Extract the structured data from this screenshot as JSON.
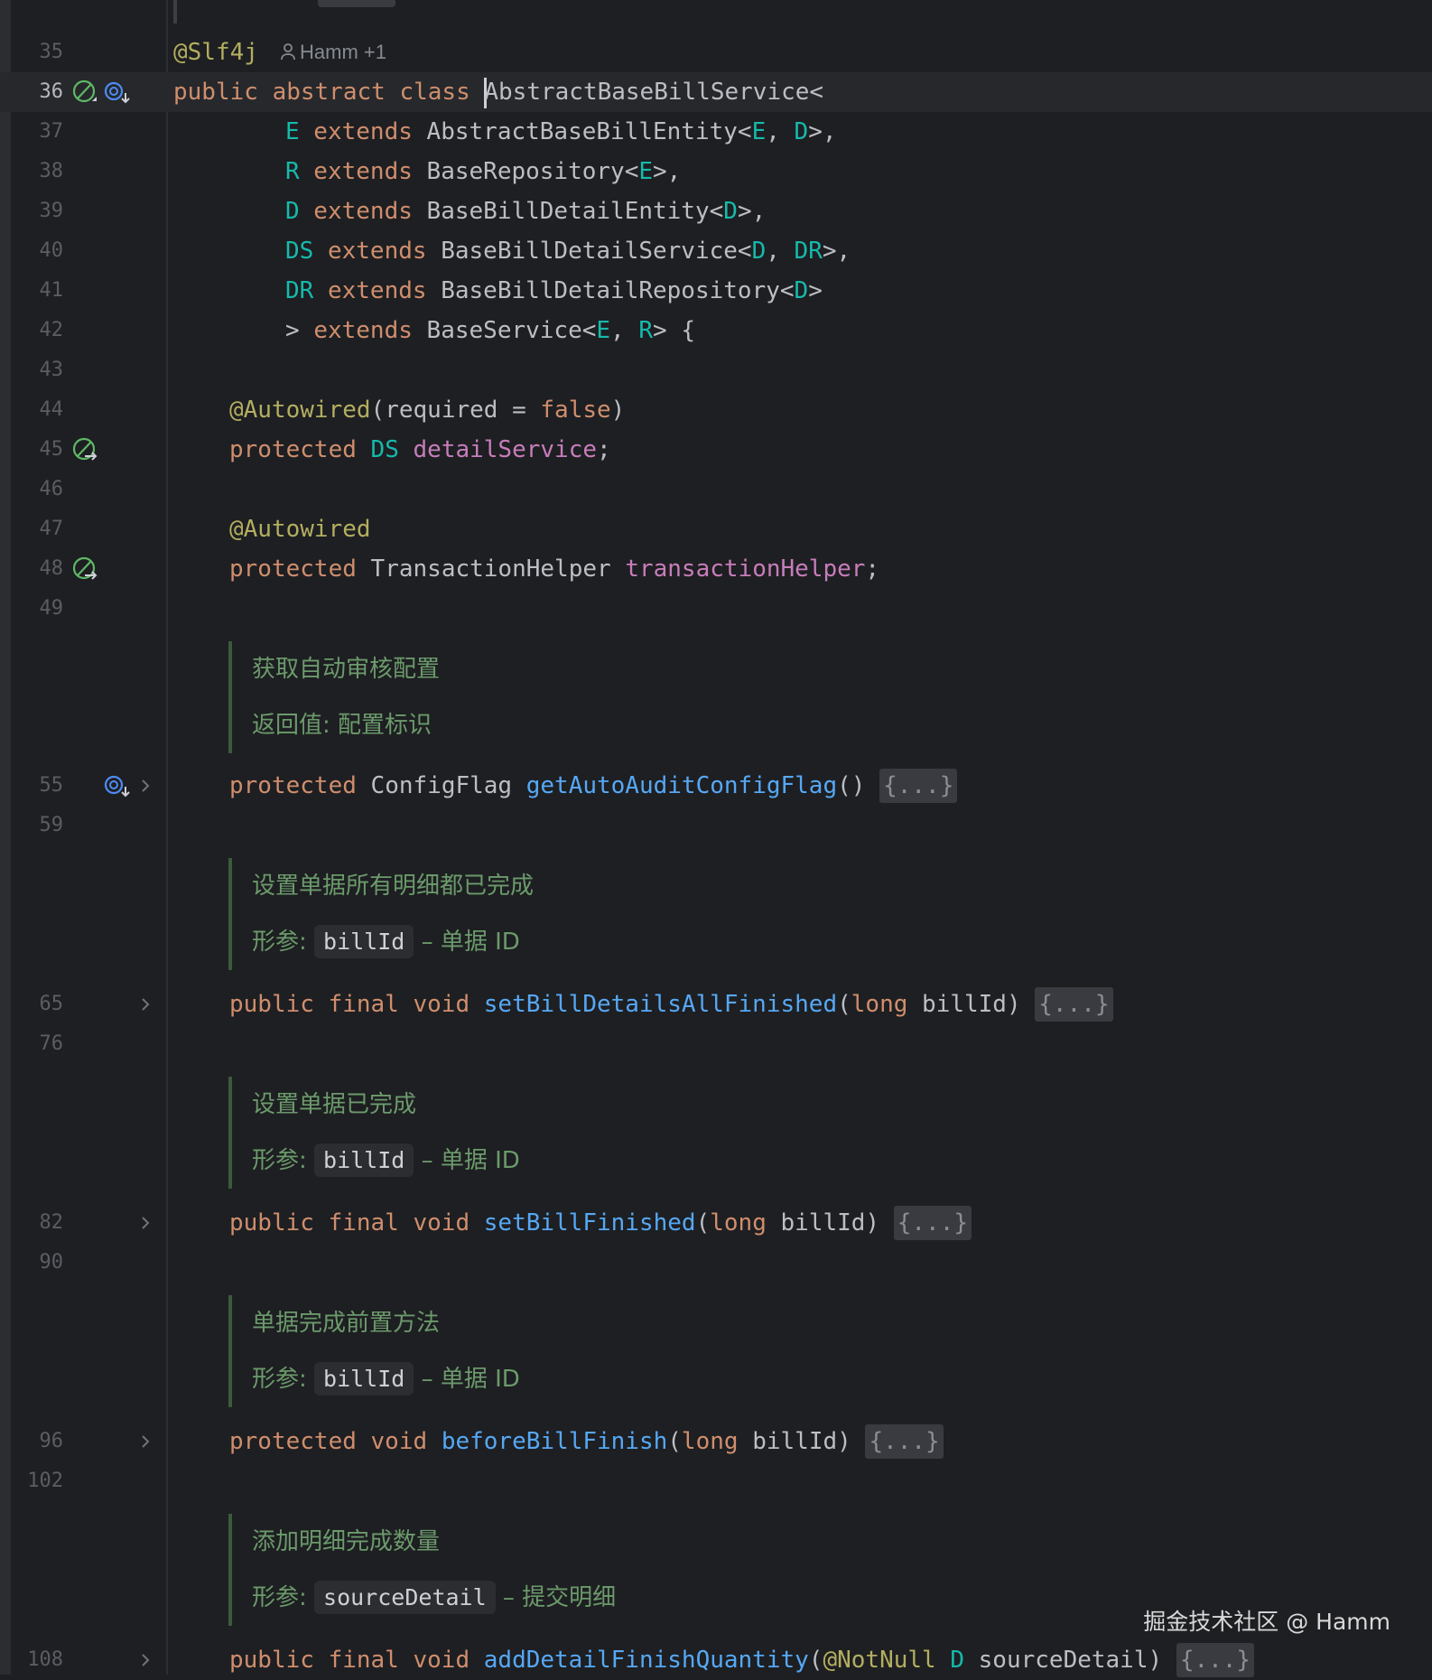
{
  "watermark": "掘金技术社区 @ Hamm",
  "author_hint": "Hamm +1",
  "icons": {
    "bean": "spring-bean-icon",
    "override": "implemented-method-icon",
    "fold": "chevron-right-icon",
    "author": "person-icon"
  },
  "colors": {
    "keyword": "#cf8e6d",
    "type_param": "#16baac",
    "method": "#56a8f5",
    "field": "#c77dbb",
    "annotation": "#b3ae60",
    "doc": "#6b9a6b"
  },
  "lines": {
    "l35": {
      "num": "35",
      "ann": "@Slf4j"
    },
    "l36": {
      "num": "36",
      "kw": "public abstract class ",
      "name": "AbstractBaseBillService",
      "rest": "<"
    },
    "l37": {
      "num": "37",
      "t1": "E",
      "kw": " extends ",
      "c1": "AbstractBaseBillEntity<",
      "t2": "E",
      ",": ", ",
      "t3": "D",
      "end": ">,"
    },
    "l38": {
      "num": "38",
      "t1": "R",
      "kw": " extends ",
      "c1": "BaseRepository<",
      "t2": "E",
      "end": ">,"
    },
    "l39": {
      "num": "39",
      "t1": "D",
      "kw": " extends ",
      "c1": "BaseBillDetailEntity<",
      "t2": "D",
      "end": ">,"
    },
    "l40": {
      "num": "40",
      "t1": "DS",
      "kw": " extends ",
      "c1": "BaseBillDetailService<",
      "t2": "D",
      "sep": ", ",
      "t3": "DR",
      "end": ">,"
    },
    "l41": {
      "num": "41",
      "t1": "DR",
      "kw": " extends ",
      "c1": "BaseBillDetailRepository<",
      "t2": "D",
      "end": ">"
    },
    "l42": {
      "num": "42",
      "c0": "> ",
      "kw": "extends ",
      "c1": "BaseService<",
      "t2": "E",
      "sep": ", ",
      "t3": "R",
      "end": "> {"
    },
    "l43": {
      "num": "43"
    },
    "l44": {
      "num": "44",
      "ann": "@Autowired",
      "c1": "(required = ",
      "kw": "false",
      "end": ")"
    },
    "l45": {
      "num": "45",
      "kw": "protected ",
      "t1": "DS",
      "fld": "detailService",
      "end": ";"
    },
    "l46": {
      "num": "46"
    },
    "l47": {
      "num": "47",
      "ann": "@Autowired"
    },
    "l48": {
      "num": "48",
      "kw": "protected ",
      "c1": "TransactionHelper ",
      "fld": "transactionHelper",
      "end": ";"
    },
    "l49": {
      "num": "49"
    },
    "l55": {
      "num": "55",
      "kw": "protected ",
      "c1": "ConfigFlag ",
      "fn": "getAutoAuditConfigFlag",
      "end": "() ",
      "fold": "{...}"
    },
    "l59": {
      "num": "59"
    },
    "l65": {
      "num": "65",
      "kw": "public final void ",
      "fn": "setBillDetailsAllFinished",
      "p1": "(",
      "pkw": "long",
      "pname": " billId) ",
      "fold": "{...}"
    },
    "l76": {
      "num": "76"
    },
    "l82": {
      "num": "82",
      "kw": "public final void ",
      "fn": "setBillFinished",
      "p1": "(",
      "pkw": "long",
      "pname": " billId) ",
      "fold": "{...}"
    },
    "l90": {
      "num": "90"
    },
    "l96": {
      "num": "96",
      "kw": "protected void ",
      "fn": "beforeBillFinish",
      "p1": "(",
      "pkw": "long",
      "pname": " billId) ",
      "fold": "{...}"
    },
    "l102": {
      "num": "102"
    },
    "l108": {
      "num": "108",
      "kw": "public final void ",
      "fn": "addDetailFinishQuantity",
      "p1": "(",
      "pann": "@NotNull",
      "pt": " D",
      "pname": " sourceDetail) ",
      "fold": "{...}"
    }
  },
  "docs": [
    {
      "title": "获取自动审核配置",
      "param_label": "返回值:",
      "param_text": "配置标识"
    },
    {
      "title": "设置单据所有明细都已完成",
      "param_label": "形参:",
      "chip": "billId",
      "param_text": "– 单据 ID"
    },
    {
      "title": "设置单据已完成",
      "param_label": "形参:",
      "chip": "billId",
      "param_text": "– 单据 ID"
    },
    {
      "title": "单据完成前置方法",
      "param_label": "形参:",
      "chip": "billId",
      "param_text": "– 单据 ID"
    },
    {
      "title": "添加明细完成数量",
      "param_label": "形参:",
      "chip": "sourceDetail",
      "param_text": "– 提交明细"
    }
  ]
}
